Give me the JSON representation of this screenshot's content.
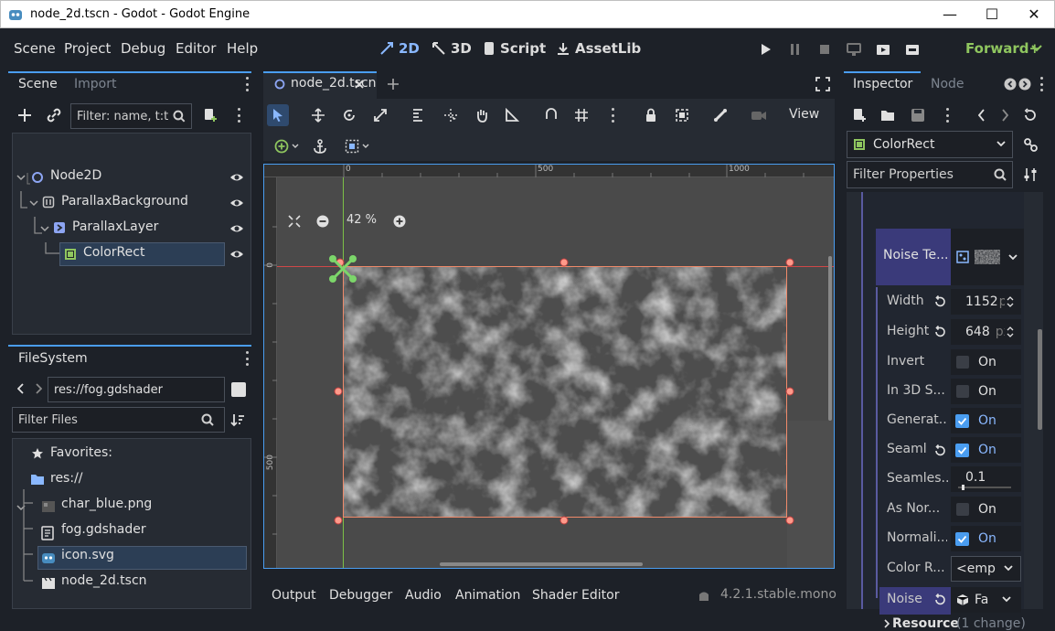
{
  "window": {
    "title": "node_2d.tscn - Godot - Godot Engine",
    "minimize": "—",
    "maximize": "☐",
    "close": "✕"
  },
  "menu": [
    "Scene",
    "Project",
    "Debug",
    "Editor",
    "Help"
  ],
  "modes": {
    "2d": "2D",
    "3d": "3D",
    "script": "Script",
    "assetlib": "AssetLib"
  },
  "renderer": "Forward+",
  "scene_dock": {
    "tabs": [
      "Scene",
      "Import"
    ],
    "filter_placeholder": "Filter: name, t:t",
    "nodes": [
      {
        "name": "Node2D"
      },
      {
        "name": "ParallaxBackground"
      },
      {
        "name": "ParallaxLayer"
      },
      {
        "name": "ColorRect"
      }
    ]
  },
  "filesystem": {
    "tab": "FileSystem",
    "path": "res://fog.gdshader",
    "filter_placeholder": "Filter Files",
    "favorites": "Favorites:",
    "root": "res://",
    "files": [
      "char_blue.png",
      "fog.gdshader",
      "icon.svg",
      "node_2d.tscn"
    ]
  },
  "editor_tab": "node_2d.tscn",
  "viewport": {
    "view_menu": "View",
    "zoom": "42 %",
    "ruler_labels": [
      "0",
      "500",
      "1000"
    ],
    "vruler_labels": [
      "0",
      "500"
    ]
  },
  "bottom_tabs": [
    "Output",
    "Debugger",
    "Audio",
    "Animation",
    "Shader Editor"
  ],
  "version": "4.2.1.stable.mono",
  "inspector": {
    "tabs": [
      "Inspector",
      "Node"
    ],
    "object": "ColorRect",
    "filter_placeholder": "Filter Properties",
    "noise_texture_label": "Noise Te...",
    "props": [
      {
        "label": "Width",
        "value": "1152",
        "unit": "px"
      },
      {
        "label": "Height",
        "value": "648",
        "unit": "px"
      },
      {
        "label": "Invert",
        "value": "On"
      },
      {
        "label": "In 3D S...",
        "value": "On"
      },
      {
        "label": "Generat...",
        "value": "On"
      },
      {
        "label": "Seaml",
        "value": "On"
      },
      {
        "label": "Seamles...",
        "value": "0.1"
      },
      {
        "label": "As Nor...",
        "value": "On"
      },
      {
        "label": "Normali...",
        "value": "On"
      },
      {
        "label": "Color R...",
        "value": "<emp"
      },
      {
        "label": "Noise",
        "value": "Fa"
      }
    ],
    "resource": "Resource",
    "resource_changes": "(1 change)"
  },
  "colors": {
    "accent": "#4a9df0",
    "selection": "#2c3e55",
    "forward": "#8fc65f"
  }
}
